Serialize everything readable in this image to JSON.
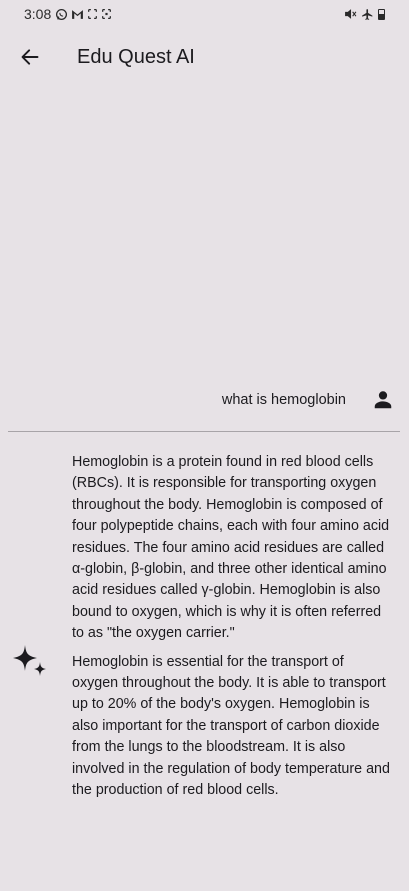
{
  "status_bar": {
    "time": "3:08",
    "left_icons": [
      "whatsapp-icon",
      "gmail-icon",
      "screen-record-icon",
      "screenshot-icon"
    ],
    "right_icons": [
      "mute-icon",
      "airplane-mode-icon",
      "battery-icon"
    ]
  },
  "app_bar": {
    "title": "Edu Quest AI",
    "back_icon": "arrow-back-icon"
  },
  "chat": {
    "user_message": "what is hemoglobin",
    "user_icon": "person-icon",
    "ai_icon": "sparkle-icon",
    "ai_paragraphs": [
      "Hemoglobin is a protein found in red blood cells (RBCs). It is responsible for transporting oxygen throughout the body. Hemoglobin is composed of four polypeptide chains, each with four amino acid residues. The four amino acid residues are called α-globin, β-globin, and three other identical amino acid residues called γ-globin. Hemoglobin is also bound to oxygen, which is why it is often referred to as \"the oxygen carrier.\"",
      "Hemoglobin is essential for the transport of oxygen throughout the body. It is able to transport up to 20% of the body's oxygen. Hemoglobin is also important for the transport of carbon dioxide from the lungs to the bloodstream. It is also involved in the regulation of body temperature and the production of red blood cells."
    ]
  },
  "colors": {
    "background": "#e7e2e6",
    "text": "#1c1b1f",
    "divider": "#a8a4a8"
  }
}
